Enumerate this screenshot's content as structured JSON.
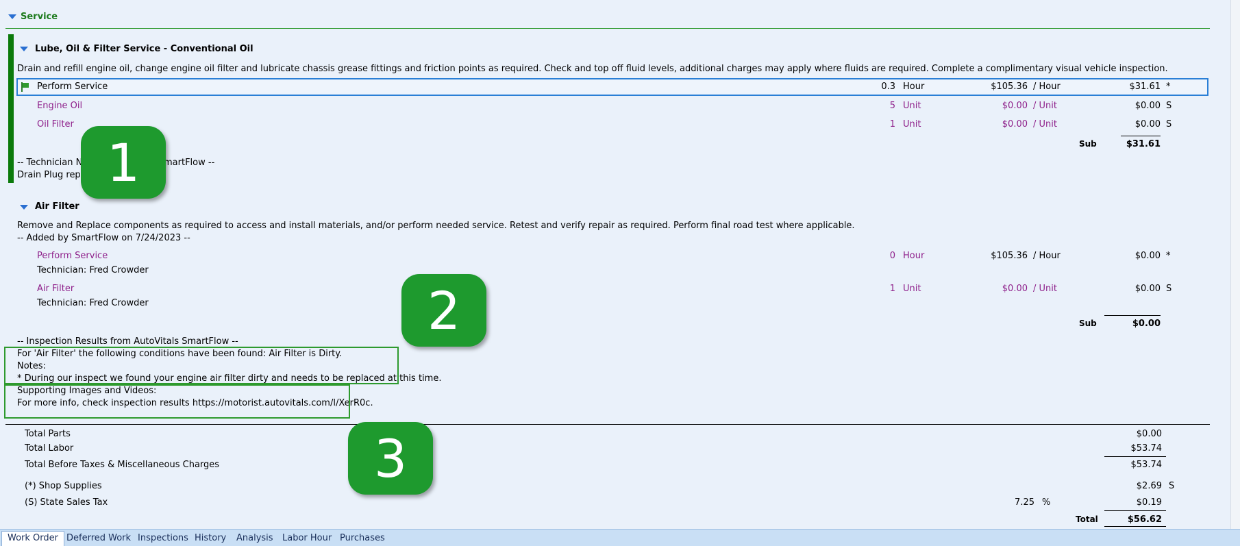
{
  "section": {
    "title": "Service"
  },
  "job1": {
    "title": "Lube, Oil & Filter Service - Conventional Oil",
    "description": "Drain and refill engine oil, change engine oil filter and lubricate chassis grease fittings and friction points as required.  Check and top off fluid levels, additional charges may apply where fluids are required.  Complete a complimentary visual vehicle inspection.",
    "lines": [
      {
        "name": "Perform Service",
        "qty": "0.3",
        "unit": "Hour",
        "rate": "$105.36",
        "per": "/ Hour",
        "amount": "$31.61",
        "flag": "*"
      },
      {
        "name": "Engine Oil",
        "qty": "5",
        "unit": "Unit",
        "rate": "$0.00",
        "per": "/ Unit",
        "amount": "$0.00",
        "flag": "S"
      },
      {
        "name": "Oil Filter",
        "qty": "1",
        "unit": "Unit",
        "rate": "$0.00",
        "per": "/ Unit",
        "amount": "$0.00",
        "flag": "S"
      }
    ],
    "sub_label": "Sub",
    "sub_value": "$31.61",
    "note_line1": "-- Technician No",
    "note_line1_tail": "martFlow --",
    "note_line2": "Drain Plug replac"
  },
  "job2": {
    "title": "Air Filter",
    "description": "Remove and Replace components as required to access and install materials, and/or perform needed service.  Retest and verify repair as required.  Perform final road test where applicable.",
    "added_by": "-- Added by SmartFlow on 7/24/2023 --",
    "lines": [
      {
        "name": "Perform Service",
        "tech": "Technician: Fred Crowder",
        "qty": "0",
        "unit": "Hour",
        "rate": "$105.36",
        "per": "/ Hour",
        "amount": "$0.00",
        "flag": "*"
      },
      {
        "name": "Air Filter",
        "tech": "Technician: Fred Crowder",
        "qty": "1",
        "unit": "Unit",
        "rate": "$0.00",
        "per": "/ Unit",
        "amount": "$0.00",
        "flag": "S"
      }
    ],
    "sub_label": "Sub",
    "sub_value": "$0.00",
    "inspection_header": "-- Inspection Results from AutoVitals SmartFlow --",
    "inspection_condition": "For 'Air Filter' the following conditions have been found: Air Filter is Dirty.",
    "notes_label": "Notes:",
    "note_text": "* During our inspect we found your engine air filter dirty and needs to be replaced at this time.",
    "media_label": "Supporting Images and Videos:",
    "more_info": "For more info, check inspection results https://motorist.autovitals.com/l/XerR0c."
  },
  "totals": {
    "parts_label": "Total Parts",
    "parts_value": "$0.00",
    "labor_label": "Total Labor",
    "labor_value": "$53.74",
    "before_tax_label": "Total Before Taxes & Miscellaneous Charges",
    "before_tax_value": "$53.74",
    "supplies_label": "(*) Shop Supplies",
    "supplies_value": "$2.69",
    "supplies_flag": "S",
    "tax_label": "(S) State Sales Tax",
    "tax_rate": "7.25",
    "tax_pct": "%",
    "tax_value": "$0.19",
    "total_label": "Total",
    "total_value": "$56.62"
  },
  "callouts": [
    "1",
    "2",
    "3"
  ],
  "tabs": [
    "Work Order",
    "Deferred Work",
    "Inspections",
    "History",
    "Analysis",
    "Labor Hour",
    "Purchases"
  ],
  "colors": {
    "accent_green": "#1e9a2e",
    "part_purple": "#8e1f8a",
    "selection_blue": "#2a7fd6"
  }
}
